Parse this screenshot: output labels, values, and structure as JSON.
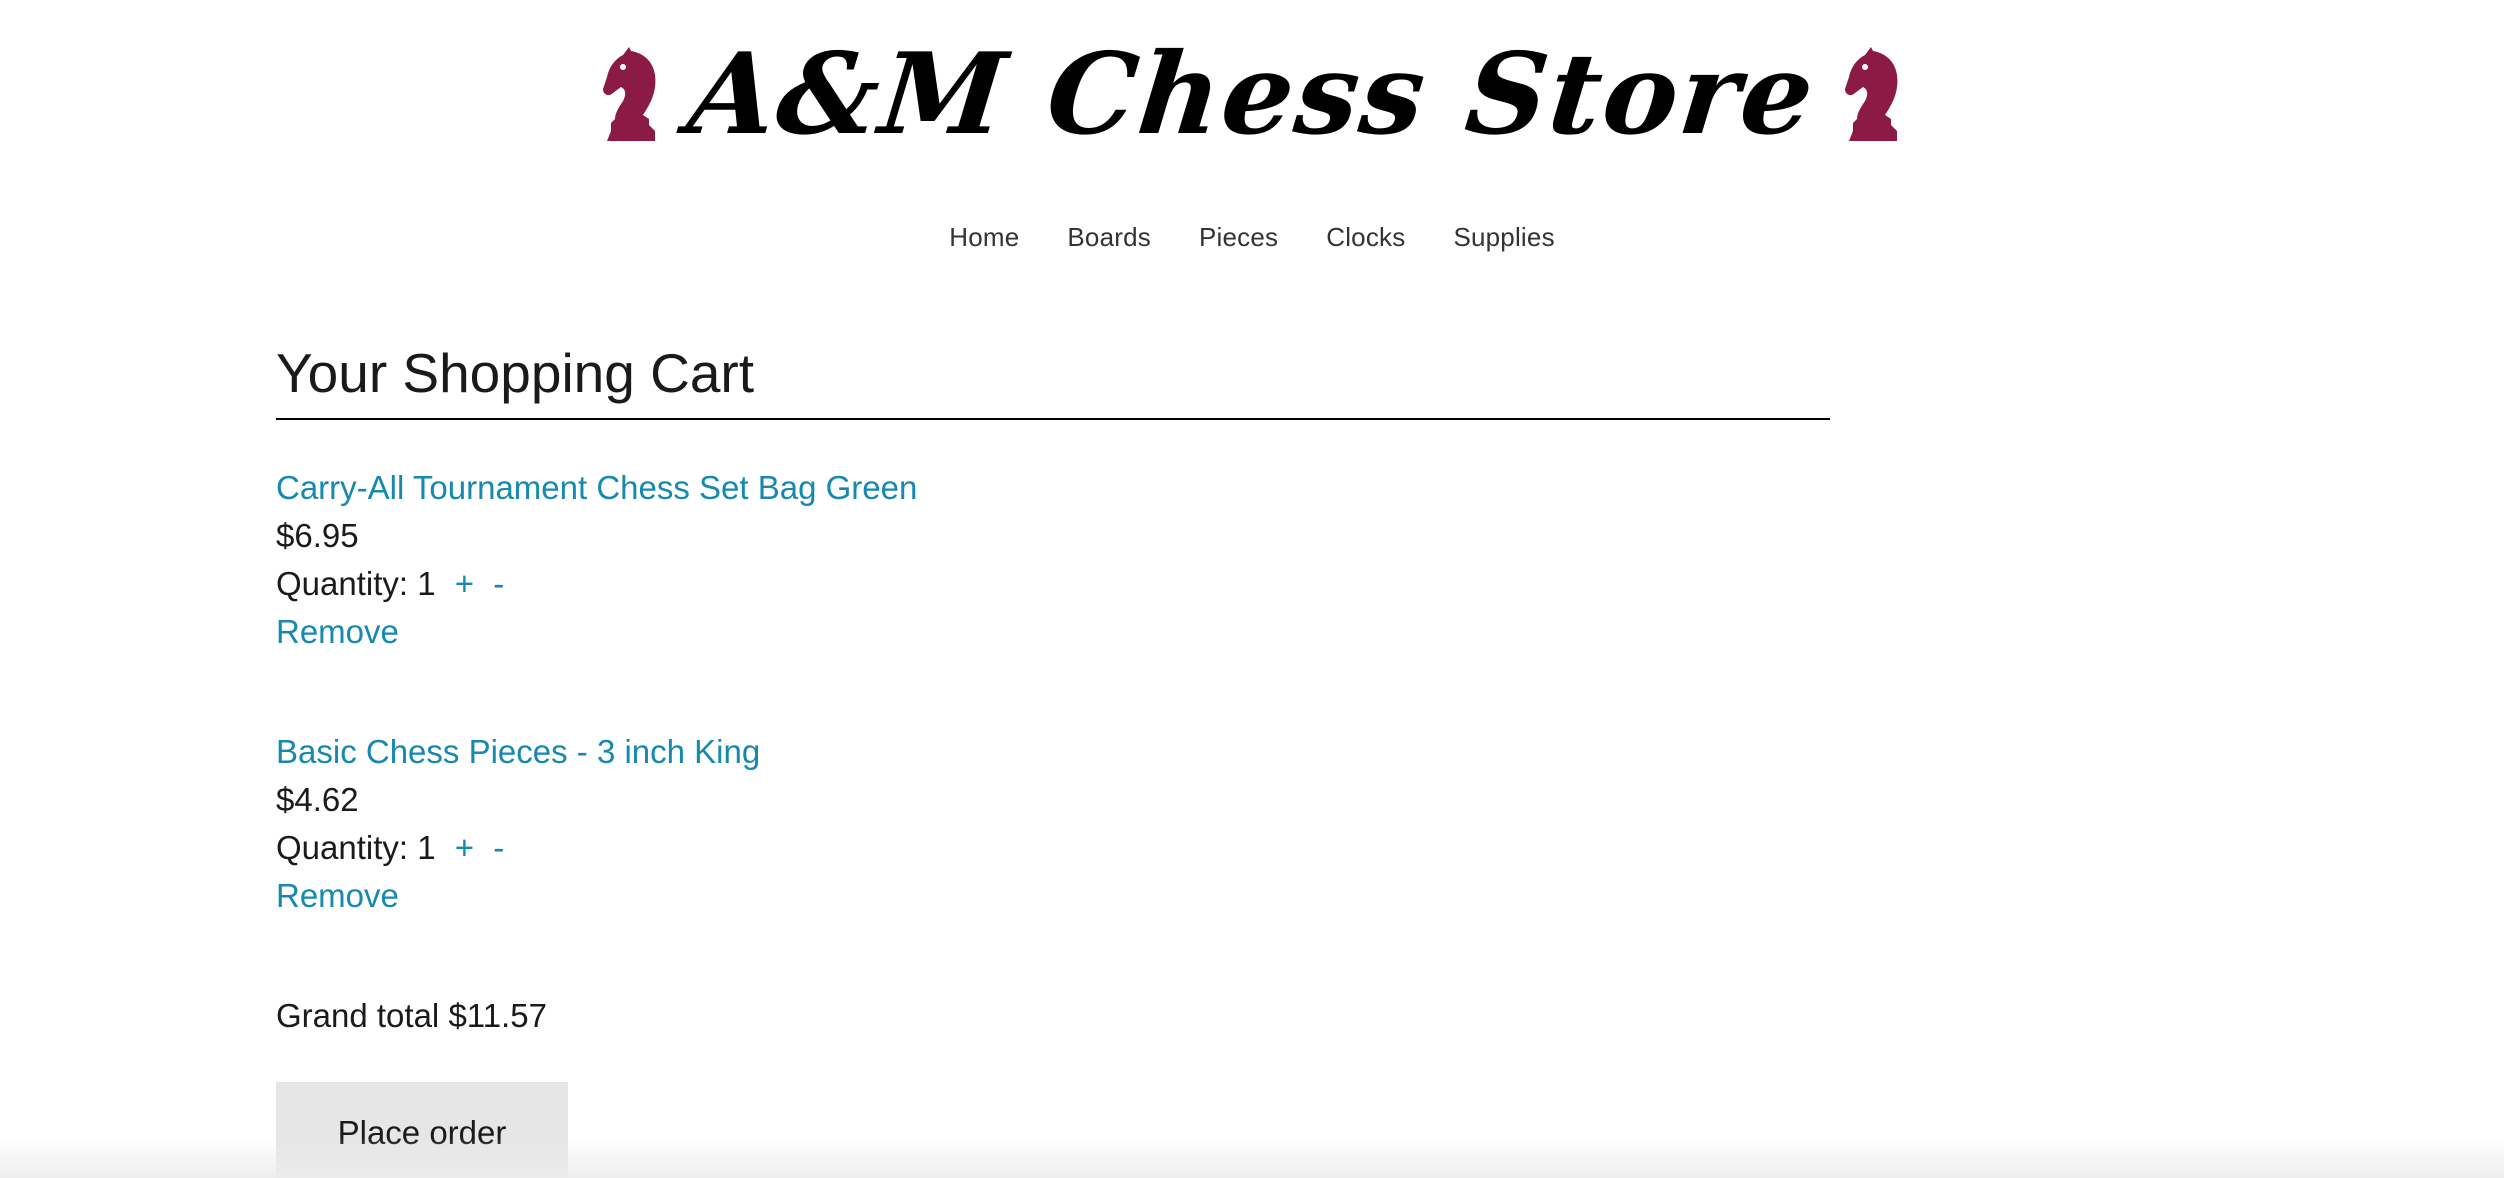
{
  "header": {
    "logo_text": "A&M Chess Store",
    "logo_icon": "knight-icon",
    "brand_color": "#8b1a44"
  },
  "nav": {
    "items": [
      {
        "label": "Home"
      },
      {
        "label": "Boards"
      },
      {
        "label": "Pieces"
      },
      {
        "label": "Clocks"
      },
      {
        "label": "Supplies"
      }
    ]
  },
  "cart": {
    "title": "Your Shopping Cart",
    "items": [
      {
        "name": "Carry-All Tournament Chess Set Bag Green",
        "price": "$6.95",
        "quantity_label": "Quantity:",
        "quantity": "1",
        "increment_label": "+",
        "decrement_label": "-",
        "remove_label": "Remove"
      },
      {
        "name": "Basic Chess Pieces - 3 inch King",
        "price": "$4.62",
        "quantity_label": "Quantity:",
        "quantity": "1",
        "increment_label": "+",
        "decrement_label": "-",
        "remove_label": "Remove"
      }
    ],
    "grand_total_label": "Grand total",
    "grand_total": "$11.57",
    "place_order_label": "Place order"
  },
  "colors": {
    "link": "#1589b0",
    "button_bg": "#e6e6e6",
    "text": "#1a1a1a"
  }
}
